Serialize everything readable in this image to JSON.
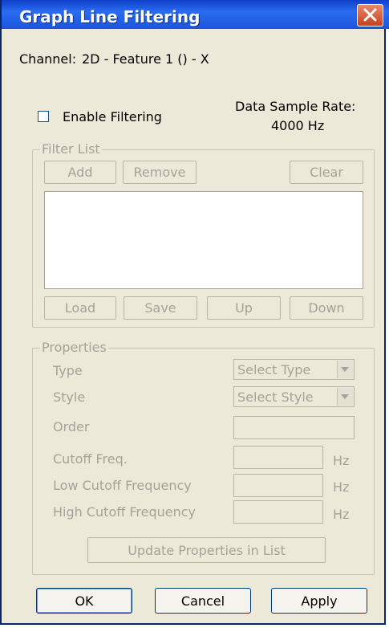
{
  "window": {
    "title": "Graph Line Filtering",
    "close_icon": "close-icon"
  },
  "channel": {
    "label": "Channel:",
    "value": "2D - Feature 1 () - X"
  },
  "filtering": {
    "enable_label": "Enable Filtering",
    "enabled": false
  },
  "sample_rate": {
    "label": "Data Sample Rate:",
    "value": "4000 Hz"
  },
  "filter_list": {
    "legend": "Filter List",
    "add": "Add",
    "remove": "Remove",
    "clear": "Clear",
    "load": "Load",
    "save": "Save",
    "up": "Up",
    "down": "Down",
    "items": []
  },
  "properties": {
    "legend": "Properties",
    "type_label": "Type",
    "type_value": "Select Type",
    "style_label": "Style",
    "style_value": "Select Style",
    "order_label": "Order",
    "cutoff_label": "Cutoff Freq.",
    "low_cutoff_label": "Low Cutoff Frequency",
    "high_cutoff_label": "High Cutoff Frequency",
    "unit": "Hz",
    "update_button": "Update Properties in List"
  },
  "footer": {
    "ok": "OK",
    "cancel": "Cancel",
    "apply": "Apply"
  },
  "colors": {
    "titlebar": "#1c55dc",
    "dialog_bg": "#ece9d8",
    "disabled_text": "#a6a29a"
  }
}
